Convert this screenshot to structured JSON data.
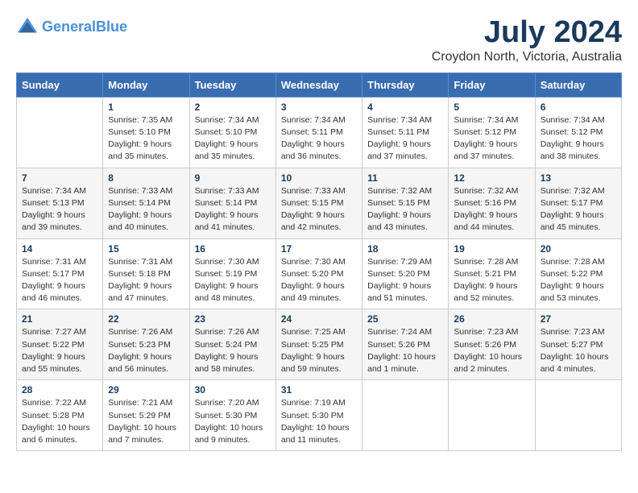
{
  "header": {
    "logo_line1": "General",
    "logo_line2": "Blue",
    "month": "July 2024",
    "location": "Croydon North, Victoria, Australia"
  },
  "weekdays": [
    "Sunday",
    "Monday",
    "Tuesday",
    "Wednesday",
    "Thursday",
    "Friday",
    "Saturday"
  ],
  "weeks": [
    [
      {
        "day": "",
        "info": ""
      },
      {
        "day": "1",
        "info": "Sunrise: 7:35 AM\nSunset: 5:10 PM\nDaylight: 9 hours\nand 35 minutes."
      },
      {
        "day": "2",
        "info": "Sunrise: 7:34 AM\nSunset: 5:10 PM\nDaylight: 9 hours\nand 35 minutes."
      },
      {
        "day": "3",
        "info": "Sunrise: 7:34 AM\nSunset: 5:11 PM\nDaylight: 9 hours\nand 36 minutes."
      },
      {
        "day": "4",
        "info": "Sunrise: 7:34 AM\nSunset: 5:11 PM\nDaylight: 9 hours\nand 37 minutes."
      },
      {
        "day": "5",
        "info": "Sunrise: 7:34 AM\nSunset: 5:12 PM\nDaylight: 9 hours\nand 37 minutes."
      },
      {
        "day": "6",
        "info": "Sunrise: 7:34 AM\nSunset: 5:12 PM\nDaylight: 9 hours\nand 38 minutes."
      }
    ],
    [
      {
        "day": "7",
        "info": "Sunrise: 7:34 AM\nSunset: 5:13 PM\nDaylight: 9 hours\nand 39 minutes."
      },
      {
        "day": "8",
        "info": "Sunrise: 7:33 AM\nSunset: 5:14 PM\nDaylight: 9 hours\nand 40 minutes."
      },
      {
        "day": "9",
        "info": "Sunrise: 7:33 AM\nSunset: 5:14 PM\nDaylight: 9 hours\nand 41 minutes."
      },
      {
        "day": "10",
        "info": "Sunrise: 7:33 AM\nSunset: 5:15 PM\nDaylight: 9 hours\nand 42 minutes."
      },
      {
        "day": "11",
        "info": "Sunrise: 7:32 AM\nSunset: 5:15 PM\nDaylight: 9 hours\nand 43 minutes."
      },
      {
        "day": "12",
        "info": "Sunrise: 7:32 AM\nSunset: 5:16 PM\nDaylight: 9 hours\nand 44 minutes."
      },
      {
        "day": "13",
        "info": "Sunrise: 7:32 AM\nSunset: 5:17 PM\nDaylight: 9 hours\nand 45 minutes."
      }
    ],
    [
      {
        "day": "14",
        "info": "Sunrise: 7:31 AM\nSunset: 5:17 PM\nDaylight: 9 hours\nand 46 minutes."
      },
      {
        "day": "15",
        "info": "Sunrise: 7:31 AM\nSunset: 5:18 PM\nDaylight: 9 hours\nand 47 minutes."
      },
      {
        "day": "16",
        "info": "Sunrise: 7:30 AM\nSunset: 5:19 PM\nDaylight: 9 hours\nand 48 minutes."
      },
      {
        "day": "17",
        "info": "Sunrise: 7:30 AM\nSunset: 5:20 PM\nDaylight: 9 hours\nand 49 minutes."
      },
      {
        "day": "18",
        "info": "Sunrise: 7:29 AM\nSunset: 5:20 PM\nDaylight: 9 hours\nand 51 minutes."
      },
      {
        "day": "19",
        "info": "Sunrise: 7:28 AM\nSunset: 5:21 PM\nDaylight: 9 hours\nand 52 minutes."
      },
      {
        "day": "20",
        "info": "Sunrise: 7:28 AM\nSunset: 5:22 PM\nDaylight: 9 hours\nand 53 minutes."
      }
    ],
    [
      {
        "day": "21",
        "info": "Sunrise: 7:27 AM\nSunset: 5:22 PM\nDaylight: 9 hours\nand 55 minutes."
      },
      {
        "day": "22",
        "info": "Sunrise: 7:26 AM\nSunset: 5:23 PM\nDaylight: 9 hours\nand 56 minutes."
      },
      {
        "day": "23",
        "info": "Sunrise: 7:26 AM\nSunset: 5:24 PM\nDaylight: 9 hours\nand 58 minutes."
      },
      {
        "day": "24",
        "info": "Sunrise: 7:25 AM\nSunset: 5:25 PM\nDaylight: 9 hours\nand 59 minutes."
      },
      {
        "day": "25",
        "info": "Sunrise: 7:24 AM\nSunset: 5:26 PM\nDaylight: 10 hours\nand 1 minute."
      },
      {
        "day": "26",
        "info": "Sunrise: 7:23 AM\nSunset: 5:26 PM\nDaylight: 10 hours\nand 2 minutes."
      },
      {
        "day": "27",
        "info": "Sunrise: 7:23 AM\nSunset: 5:27 PM\nDaylight: 10 hours\nand 4 minutes."
      }
    ],
    [
      {
        "day": "28",
        "info": "Sunrise: 7:22 AM\nSunset: 5:28 PM\nDaylight: 10 hours\nand 6 minutes."
      },
      {
        "day": "29",
        "info": "Sunrise: 7:21 AM\nSunset: 5:29 PM\nDaylight: 10 hours\nand 7 minutes."
      },
      {
        "day": "30",
        "info": "Sunrise: 7:20 AM\nSunset: 5:30 PM\nDaylight: 10 hours\nand 9 minutes."
      },
      {
        "day": "31",
        "info": "Sunrise: 7:19 AM\nSunset: 5:30 PM\nDaylight: 10 hours\nand 11 minutes."
      },
      {
        "day": "",
        "info": ""
      },
      {
        "day": "",
        "info": ""
      },
      {
        "day": "",
        "info": ""
      }
    ]
  ]
}
